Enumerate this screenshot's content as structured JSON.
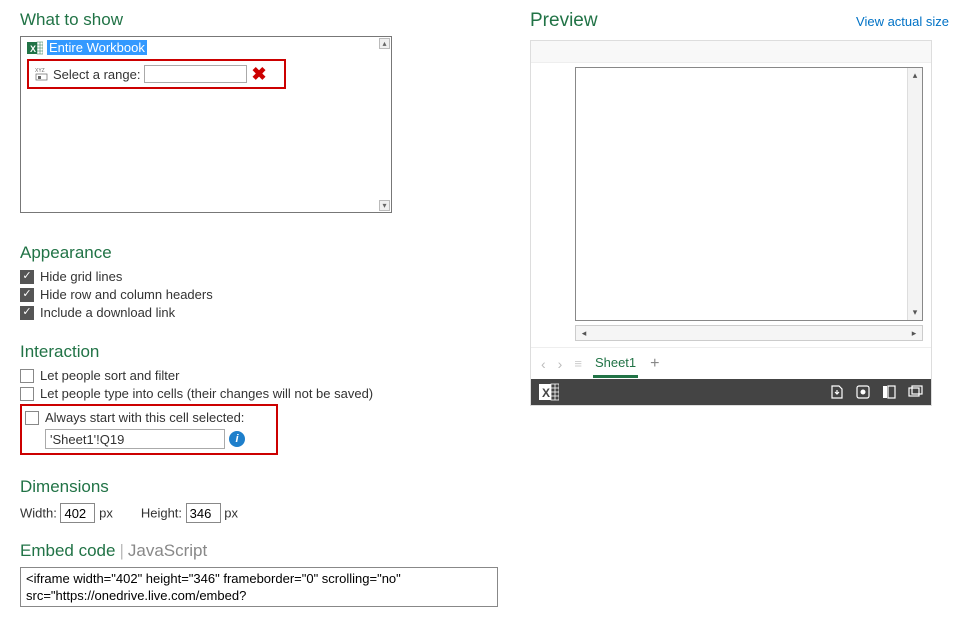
{
  "whatToShow": {
    "title": "What to show",
    "workbookLabel": "Entire Workbook",
    "selectRangeLabel": "Select a range:",
    "rangeValue": ""
  },
  "appearance": {
    "title": "Appearance",
    "hideGridLabel": "Hide grid lines",
    "hideHeadersLabel": "Hide row and column headers",
    "downloadLabel": "Include a download link"
  },
  "interaction": {
    "title": "Interaction",
    "sortFilterLabel": "Let people sort and filter",
    "typeCellsLabel": "Let people type into cells (their changes will not be saved)",
    "startCellLabel": "Always start with this cell selected:",
    "startCellValue": "'Sheet1'!Q19"
  },
  "dimensions": {
    "title": "Dimensions",
    "widthLabel": "Width:",
    "widthValue": "402",
    "heightLabel": "Height:",
    "heightValue": "346",
    "unit": "px"
  },
  "embed": {
    "title": "Embed code",
    "jsLabel": "JavaScript",
    "code": "<iframe width=\"402\" height=\"346\" frameborder=\"0\" scrolling=\"no\" src=\"https://onedrive.live.com/embed?"
  },
  "preview": {
    "title": "Preview",
    "viewActual": "View actual size",
    "sheetName": "Sheet1"
  }
}
